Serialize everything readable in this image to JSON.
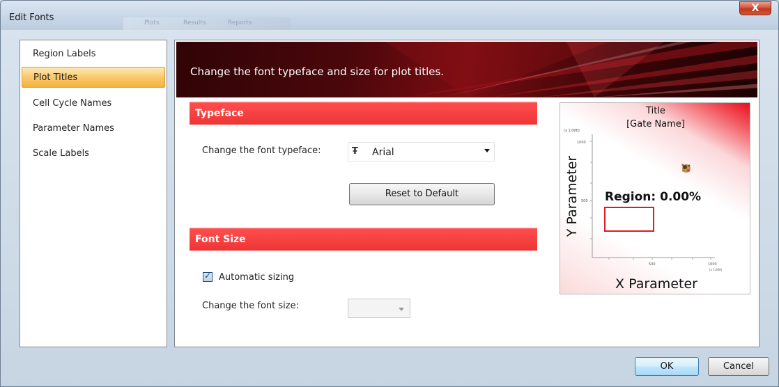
{
  "window": {
    "title": "Edit Fonts",
    "ghost_tabs": [
      "Plots",
      "Results",
      "Reports"
    ],
    "close_glyph": "X"
  },
  "sidebar": {
    "items": [
      {
        "label": "Region Labels",
        "selected": false
      },
      {
        "label": "Plot Titles",
        "selected": true
      },
      {
        "label": "Cell Cycle Names",
        "selected": false
      },
      {
        "label": "Parameter Names",
        "selected": false
      },
      {
        "label": "Scale Labels",
        "selected": false
      }
    ]
  },
  "banner": {
    "text": "Change the font typeface and size for plot titles."
  },
  "typeface": {
    "header": "Typeface",
    "label": "Change the font typeface:",
    "icon": "font-type-icon",
    "icon_glyph": "Ŧ",
    "value": "Arial",
    "reset_label": "Reset to Default"
  },
  "font_size": {
    "header": "Font Size",
    "auto_label": "Automatic sizing",
    "auto_checked": true,
    "size_label": "Change the font size:",
    "size_value": ""
  },
  "preview": {
    "title": "Title",
    "gate": "[Gate Name]",
    "y_label": "Y Parameter",
    "x_label": "X Parameter",
    "region": "Region: 0.00%",
    "y_multiplier": "(x 1,000)",
    "y_tick_top": "1000",
    "y_tick_mid": "500",
    "x_tick_mid": "500",
    "x_tick_right": "1000",
    "x_multiplier": "(x 1,000)",
    "region_color": "#e01a22"
  },
  "footer": {
    "ok_label": "OK",
    "cancel_label": "Cancel"
  },
  "colors": {
    "section_header": "#f23b3b",
    "banner": "#5a080c",
    "selected_item": "#f8c25a"
  }
}
